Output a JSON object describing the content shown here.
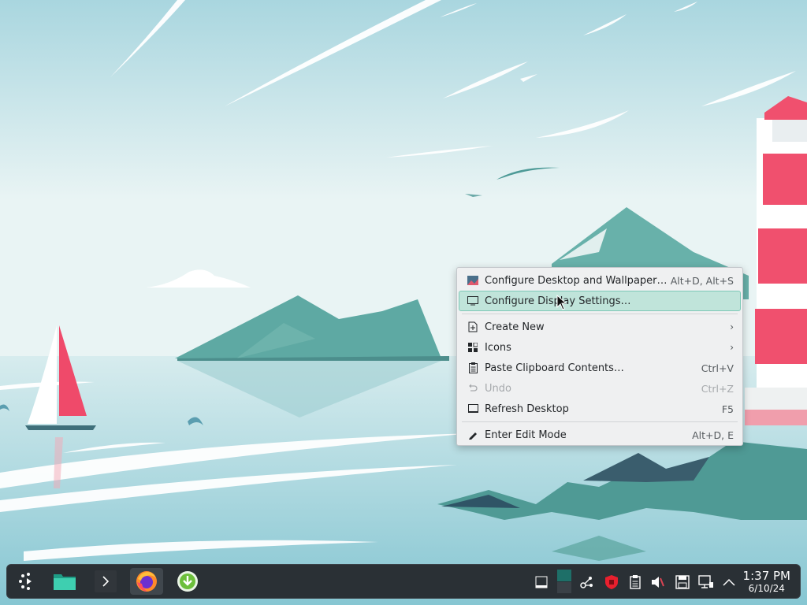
{
  "context_menu": {
    "items": [
      {
        "label": "Configure Desktop and Wallpaper…",
        "shortcut": "Alt+D, Alt+S",
        "icon": "wallpaper-icon"
      },
      {
        "label": "Configure Display Settings…",
        "shortcut": "",
        "icon": "display-icon",
        "highlighted": true
      },
      {
        "label": "Create New",
        "shortcut": "",
        "icon": "new-document-icon",
        "submenu": true
      },
      {
        "label": "Icons",
        "shortcut": "",
        "icon": "icons-grid-icon",
        "submenu": true
      },
      {
        "label": "Paste Clipboard Contents…",
        "shortcut": "Ctrl+V",
        "icon": "clipboard-icon"
      },
      {
        "label": "Undo",
        "shortcut": "Ctrl+Z",
        "icon": "undo-icon",
        "disabled": true
      },
      {
        "label": "Refresh Desktop",
        "shortcut": "F5",
        "icon": "refresh-icon"
      },
      {
        "label": "Enter Edit Mode",
        "shortcut": "Alt+D, E",
        "icon": "edit-pencil-icon"
      }
    ],
    "submenu_arrow": "›"
  },
  "taskbar": {
    "launchers": [
      {
        "name": "application-launcher",
        "icon": "kde-launcher-icon"
      },
      {
        "name": "file-manager",
        "icon": "folder-icon"
      },
      {
        "name": "terminal",
        "icon": "terminal-icon"
      },
      {
        "name": "firefox",
        "icon": "firefox-icon",
        "active": true
      },
      {
        "name": "updates",
        "icon": "download-arrow-icon"
      }
    ],
    "tray": [
      "show-desktop-icon",
      "virtual-desktop-icon",
      "kde-connect-icon",
      "security-shield-icon",
      "clipboard-tray-icon",
      "volume-muted-icon",
      "storage-icon",
      "network-icon",
      "expand-tray-icon"
    ],
    "clock": {
      "time": "1:37 PM",
      "date": "6/10/24"
    }
  },
  "colors": {
    "sky": "#cfe6ea",
    "sea": "#9fd0d8",
    "mountain": "#5ea9a3",
    "lighthouse_red": "#f0506e",
    "menu_highlight": "#c0e4da",
    "taskbar": "#2a3035"
  }
}
